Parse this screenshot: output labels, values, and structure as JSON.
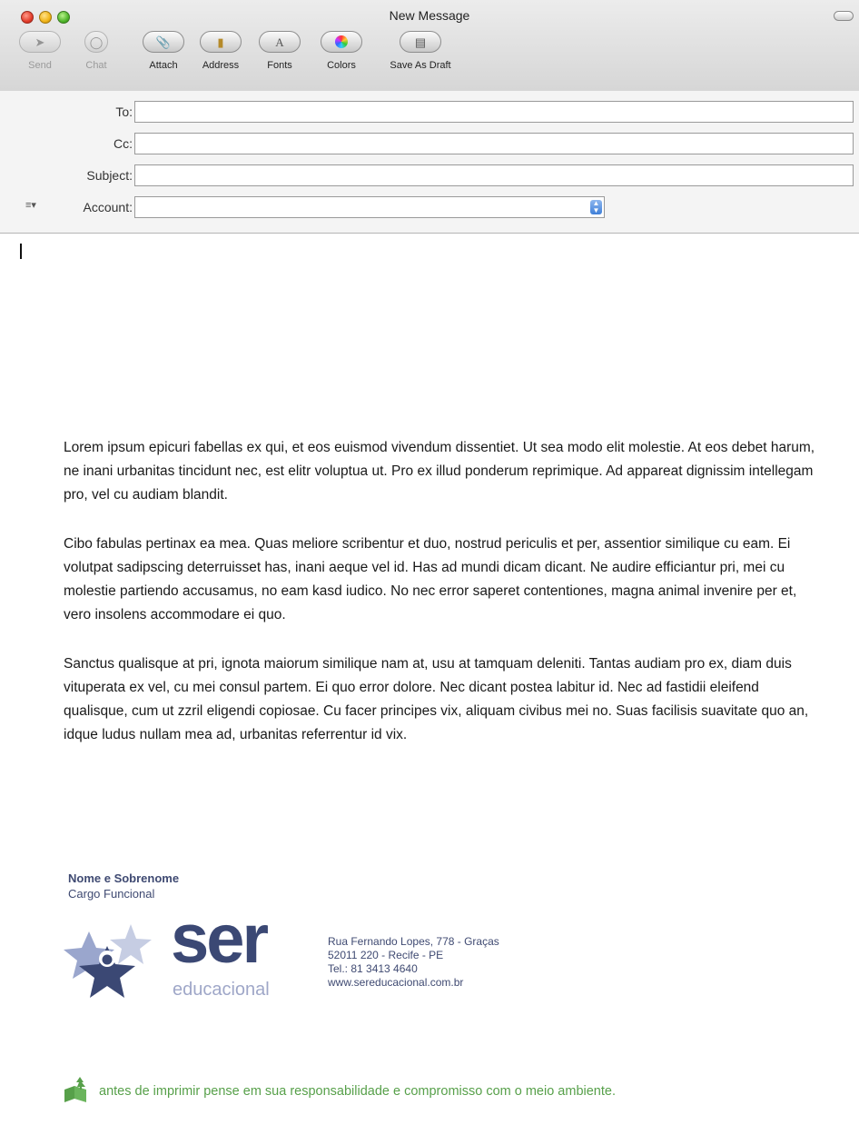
{
  "window": {
    "title": "New Message"
  },
  "toolbar": {
    "send": "Send",
    "chat": "Chat",
    "attach": "Attach",
    "address": "Address",
    "fonts": "Fonts",
    "colors": "Colors",
    "save_draft": "Save As Draft"
  },
  "headers": {
    "to_label": "To:",
    "cc_label": "Cc:",
    "subject_label": "Subject:",
    "account_label": "Account:",
    "to_value": "",
    "cc_value": "",
    "subject_value": "",
    "account_value": ""
  },
  "body": {
    "paragraphs": [
      "Lorem ipsum epicuri fabellas ex qui, et eos euismod vivendum dissentiet. Ut sea modo elit molestie. At eos debet harum, ne inani urbanitas tincidunt nec, est elitr voluptua ut. Pro ex illud ponderum reprimique. Ad appareat dignissim intellegam pro, vel cu audiam blandit.",
      "Cibo fabulas pertinax ea mea. Quas meliore scribentur et duo, nostrud periculis et per, assentior similique cu eam. Ei volutpat sadipscing deterruisset has, inani aeque vel id. Has ad mundi dicam dicant. Ne audire efficiantur pri, mei cu molestie partiendo accusamus, no eam kasd iudico. No nec error saperet contentiones, magna animal invenire per et, vero insolens accommodare ei quo.",
      "Sanctus qualisque at pri, ignota maiorum similique nam at, usu at tamquam deleniti. Tantas audiam pro ex, diam duis vituperata ex vel, cu mei consul partem. Ei quo error dolore. Nec dicant postea labitur id. Nec ad fastidii eleifend qualisque, cum ut zzril eligendi copiosae. Cu facer principes vix, aliquam civibus mei no. Suas facilisis suavitate quo an, idque ludus nullam mea ad, urbanitas referrentur id vix."
    ]
  },
  "signature": {
    "name": "Nome e Sobrenome",
    "role": "Cargo Funcional",
    "logo_word": "ser",
    "logo_sub": "educacional",
    "address_lines": [
      "Rua Fernando Lopes, 778 - Graças",
      "52011 220 - Recife - PE",
      "Tel.: 81 3413 4640",
      "www.sereducacional.com.br"
    ],
    "eco_note": "antes de imprimir pense em sua responsabilidade e compromisso com o meio ambiente."
  },
  "colors": {
    "brand_navy": "#3b4874",
    "brand_light": "#9fa7c8",
    "eco_green": "#57a04a"
  },
  "icons": [
    "send-icon",
    "chat-icon",
    "attach-icon",
    "address-book-icon",
    "fonts-icon",
    "color-wheel-icon",
    "save-draft-icon",
    "list-menu-icon",
    "stepper-icon",
    "tree-icon"
  ]
}
